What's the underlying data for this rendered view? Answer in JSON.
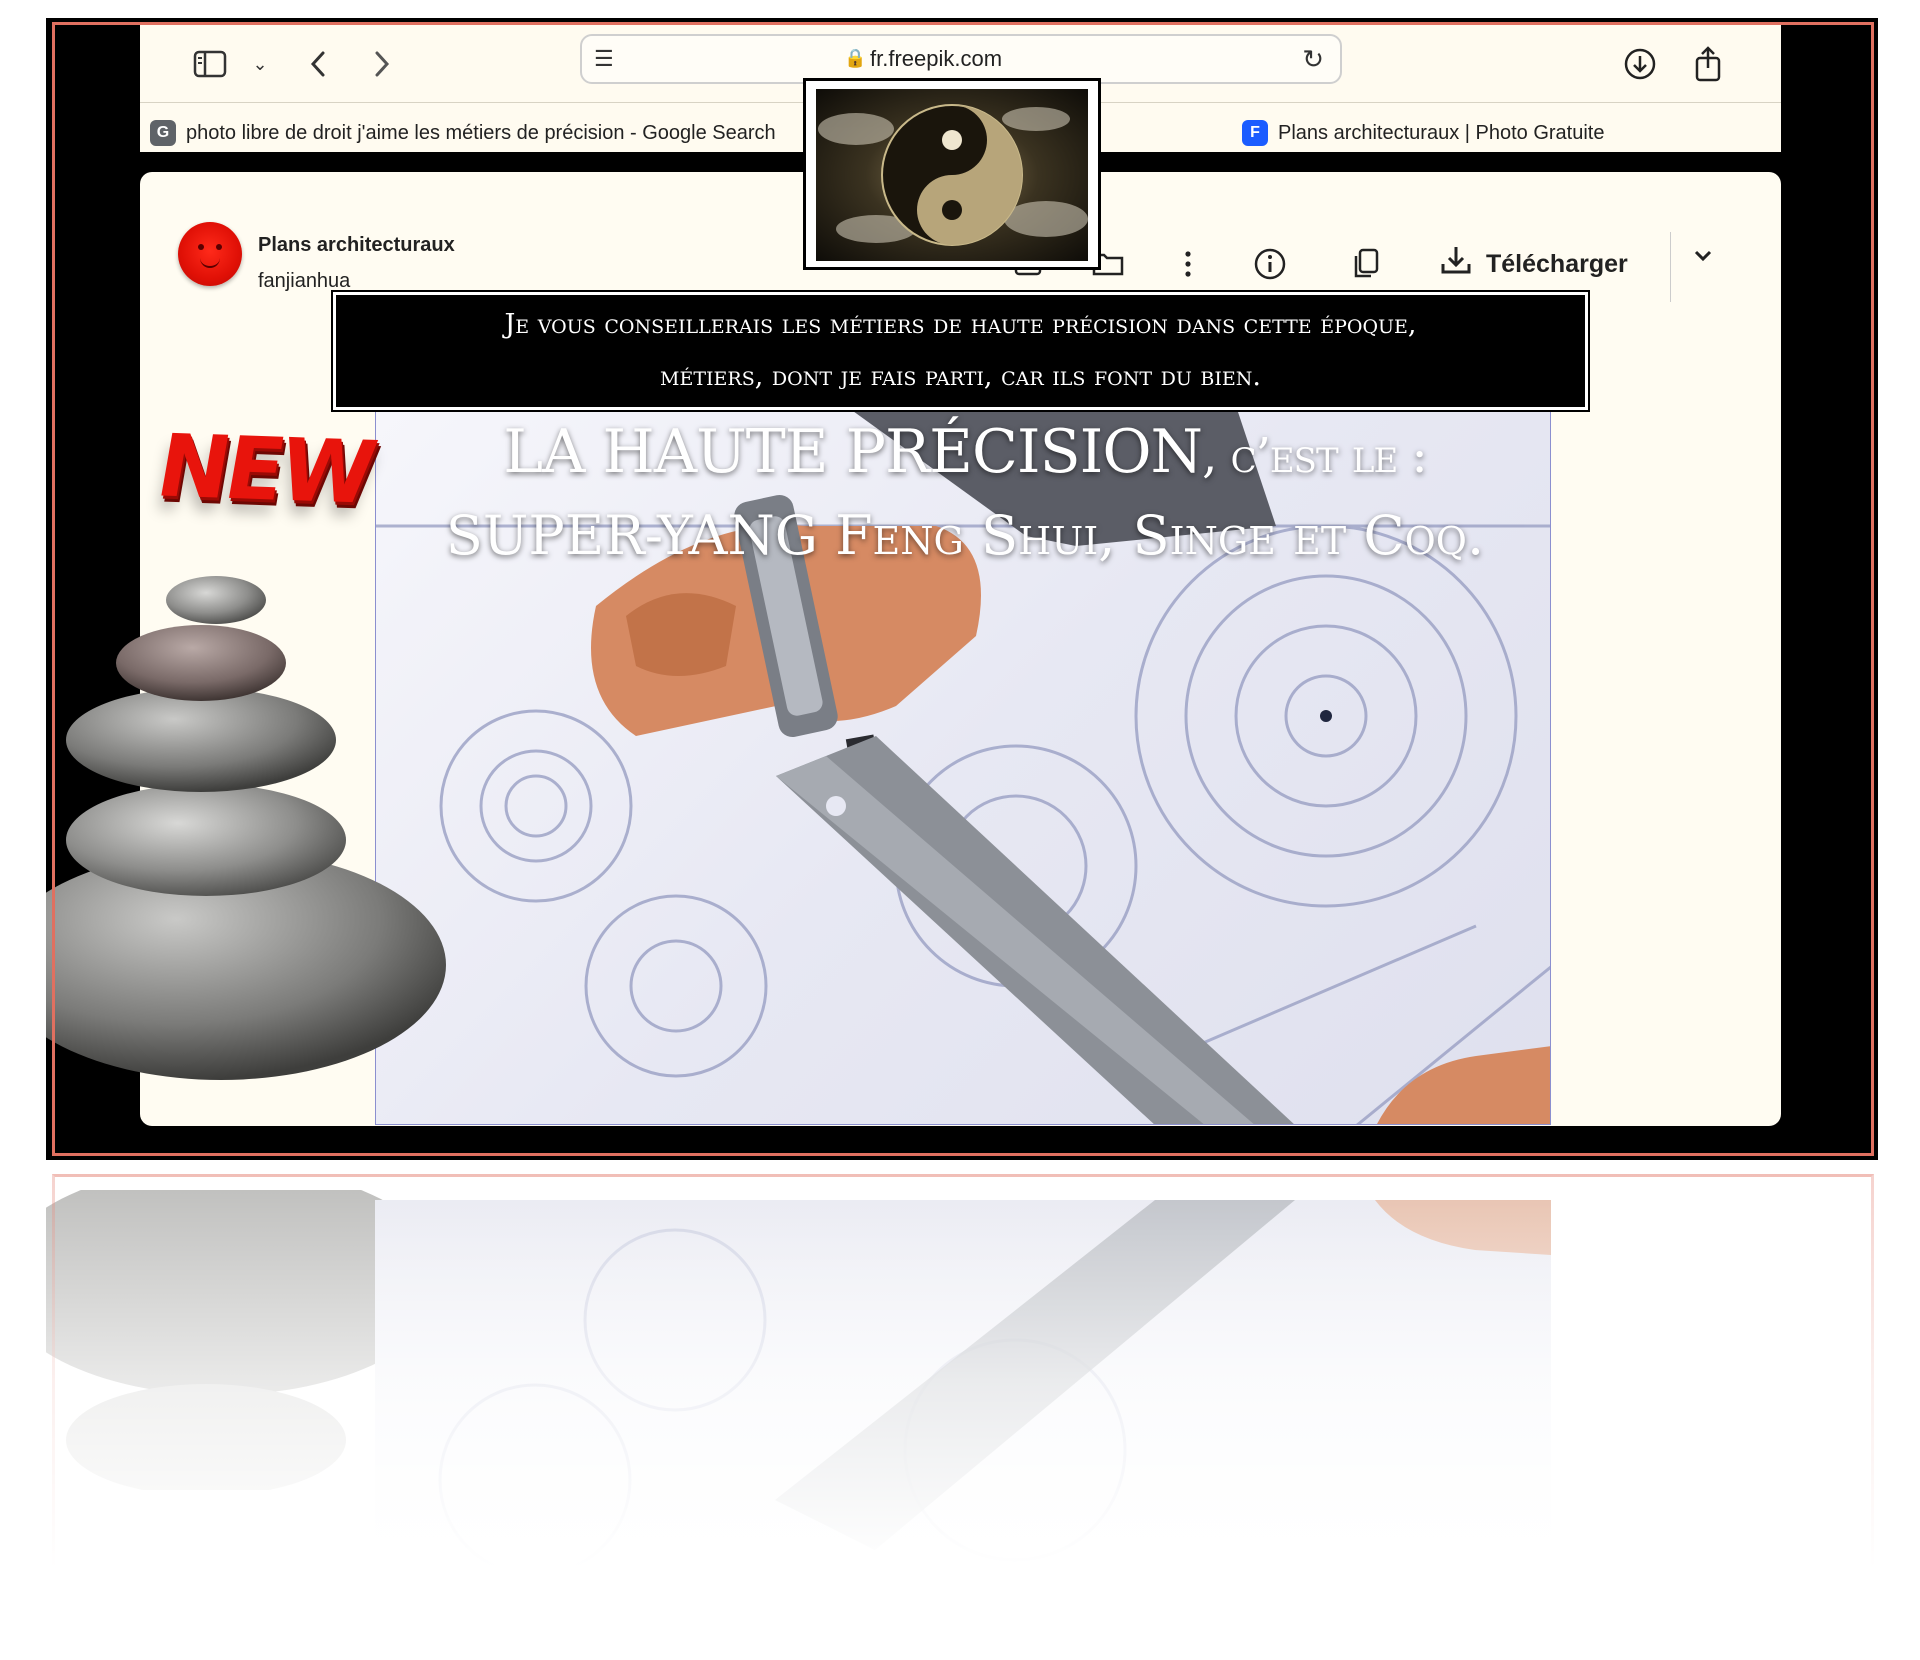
{
  "browser": {
    "url": "fr.freepik.com",
    "tabs": [
      {
        "favicon": "G",
        "title": "photo libre de droit j'aime les métiers de précision - Google Search",
        "color": "#5f6368"
      },
      {
        "favicon": "F",
        "title": "Plans architecturaux | Photo Gratuite",
        "color": "#1b5cff"
      }
    ]
  },
  "page": {
    "author_title": "Plans architecturaux",
    "author_name": "fanjianhua",
    "download_label": "Télécharger",
    "icons": [
      "image-icon",
      "folder-heart-icon",
      "more-vertical-icon",
      "info-icon",
      "copy-icon",
      "download-icon",
      "chevron-down-icon"
    ]
  },
  "overlay": {
    "caption_line1": "Je vous conseillerais les métiers de haute précision dans cette époque,",
    "caption_line2": "métiers, dont je fais parti, car ils font du bien.",
    "headline_line1_main": "LA HAUTE PRÉCISION",
    "headline_line1_tail": ", c’est le :",
    "headline_line2_main": "SUPER-YANG ",
    "headline_line2_tail": "Feng Shui, Singe et Coq.",
    "badge": "NEW"
  },
  "colors": {
    "frame": "#000000",
    "outline": "#e07060",
    "toolbar_bg": "#fffbf0",
    "card_bg": "#fffcf2",
    "badge": "#e8140c"
  }
}
